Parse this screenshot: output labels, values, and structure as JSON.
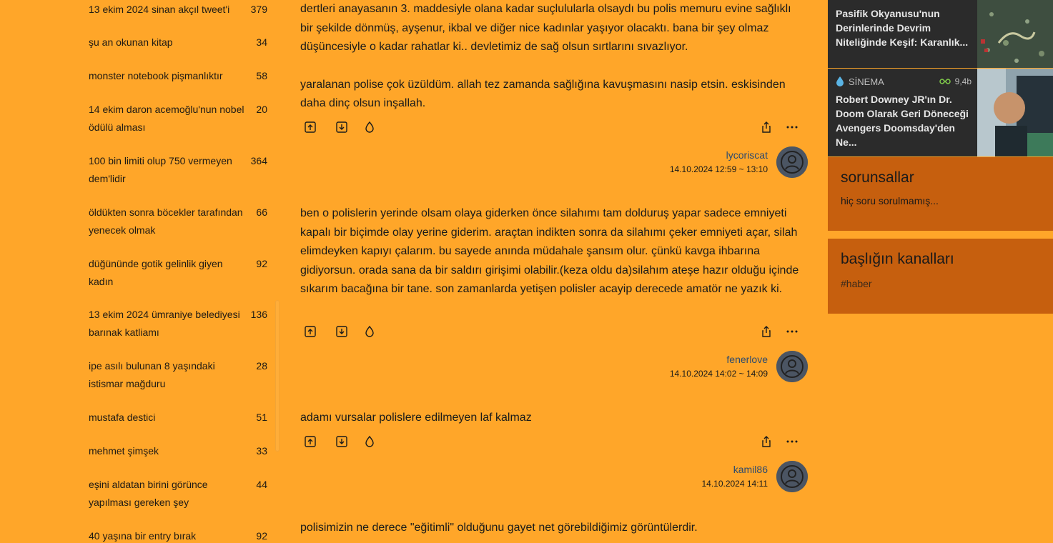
{
  "topics": [
    {
      "title": "13 ekim 2024 sinan akçıl tweet'i",
      "count": "379"
    },
    {
      "title": "şu an okunan kitap",
      "count": "34"
    },
    {
      "title": "monster notebook pişmanlıktır",
      "count": "58"
    },
    {
      "title": "14 ekim daron acemoğlu'nun nobel ödülü alması",
      "count": "20"
    },
    {
      "title": "100 bin limiti olup 750 vermeyen dem'lidir",
      "count": "364"
    },
    {
      "title": "öldükten sonra böcekler tarafından yenecek olmak",
      "count": "66"
    },
    {
      "title": "düğününde gotik gelinlik giyen kadın",
      "count": "92"
    },
    {
      "title": "13 ekim 2024 ümraniye belediyesi barınak katliamı",
      "count": "136"
    },
    {
      "title": "ipe asılı bulunan 8 yaşındaki istismar mağduru",
      "count": "28"
    },
    {
      "title": "mustafa destici",
      "count": "51"
    },
    {
      "title": "mehmet şimşek",
      "count": "33"
    },
    {
      "title": "eşini aldatan birini görünce yapılması gereken şey",
      "count": "44"
    },
    {
      "title": "40 yaşına bir entry bırak",
      "count": "92"
    }
  ],
  "entries": [
    {
      "paragraphs": [
        "dertleri anayasanın 3. maddesiyle olana kadar suçlulularla olsaydı bu polis memuru evine sağlıklı bir şekilde dönmüş, ayşenur, ikbal ve diğer nice kadınlar yaşıyor olacaktı. bana bir şey olmaz düşüncesiyle o kadar rahatlar ki.. devletimiz de sağ olsun sırtlarını sıvazlıyor.",
        "yaralanan polise çok üzüldüm. allah tez zamanda sağlığına kavuşmasını nasip etsin. eskisinden daha dinç olsun inşallah."
      ],
      "author": "lycoriscat",
      "date": "14.10.2024 12:59 ~ 13:10"
    },
    {
      "paragraphs": [
        "ben o polislerin yerinde olsam olaya giderken önce silahımı tam dolduruş yapar sadece emniyeti kapalı bir biçimde olay yerine giderim. araçtan indikten sonra da silahımı çeker emniyeti açar, silah elimdeyken kapıyı çalarım. bu sayede anında müdahale şansım olur. çünkü kavga ihbarına gidiyorsun. orada sana da bir saldırı girişimi olabilir.(keza oldu da)silahım ateşe hazır olduğu içinde sıkarım bacağına bir tane. son zamanlarda yetişen polisler acayip derecede amatör ne yazık ki."
      ],
      "author": "fenerlove",
      "date": "14.10.2024 14:02 ~ 14:09"
    },
    {
      "paragraphs": [
        "adamı vursalar polislere edilmeyen laf kalmaz"
      ],
      "author": "kamil86",
      "date": "14.10.2024 14:11"
    },
    {
      "paragraphs": [
        "polisimizin ne derece \"eğitimli\" olduğunu gayet net görebildiğimiz görüntülerdir."
      ]
    }
  ],
  "news": [
    {
      "title": "Pasifik Okyanusu'nun Derinlerinde Devrim Niteliğinde Keşif: Karanlık..."
    },
    {
      "category": "SİNEMA",
      "views": "9,4b",
      "title": "Robert Downey JR'ın Dr. Doom Olarak Geri Döneceği Avengers Doomsday'den Ne..."
    }
  ],
  "widgets": {
    "questions": {
      "title": "sorunsallar",
      "body": "hiç soru sorulmamış..."
    },
    "channels": {
      "title": "başlığın kanalları",
      "tag": "#haber"
    }
  },
  "colors": {
    "background": "#ffa629",
    "widget": "#c65f0e",
    "card": "#2b2b2b",
    "author": "#2d4a6e"
  }
}
